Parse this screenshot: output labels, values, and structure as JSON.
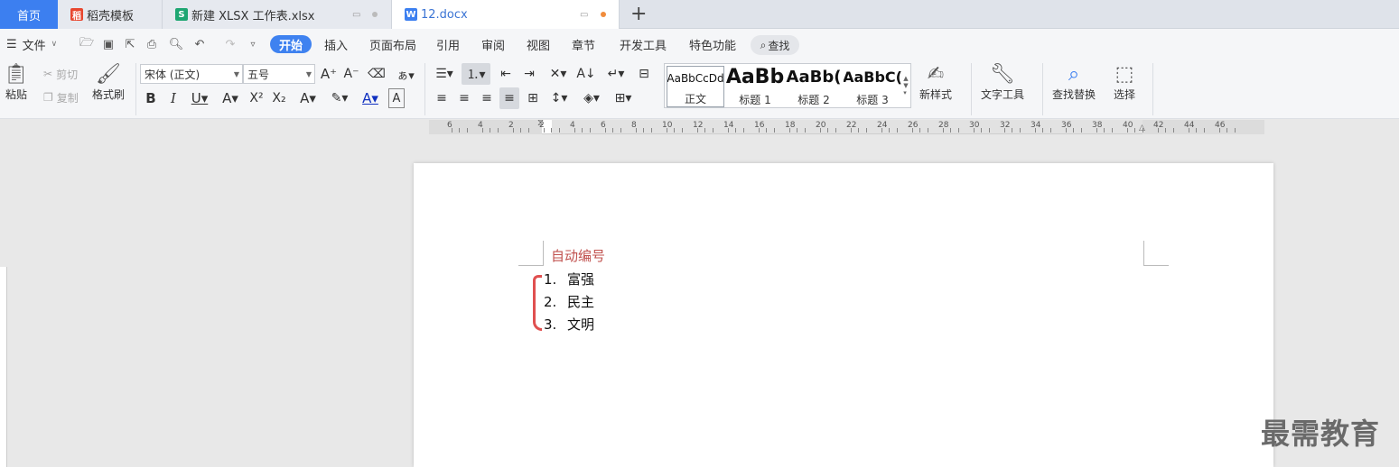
{
  "tabs": {
    "home": "首页",
    "template": "稻壳模板",
    "xlsx": "新建 XLSX 工作表.xlsx",
    "docx": "12.docx"
  },
  "menu": {
    "file": "文件",
    "items": [
      "开始",
      "插入",
      "页面布局",
      "引用",
      "审阅",
      "视图",
      "章节",
      "开发工具",
      "特色功能"
    ],
    "search": "查找"
  },
  "ribbon": {
    "paste": "粘贴",
    "cut": "剪切",
    "copy": "复制",
    "format_painter": "格式刷",
    "font_name": "宋体 (正文)",
    "font_size": "五号",
    "styles": [
      {
        "preview": "AaBbCcDd",
        "name": "正文"
      },
      {
        "preview": "AaBb",
        "name": "标题 1"
      },
      {
        "preview": "AaBb(",
        "name": "标题 2"
      },
      {
        "preview": "AaBbC(",
        "name": "标题 3"
      }
    ],
    "new_style": "新样式",
    "text_tools": "文字工具",
    "find_replace": "查找替换",
    "select": "选择"
  },
  "ruler": {
    "numbers": [
      "6",
      "4",
      "2",
      "2",
      "4",
      "6",
      "8",
      "10",
      "12",
      "14",
      "16",
      "18",
      "20",
      "22",
      "24",
      "26",
      "28",
      "30",
      "32",
      "34",
      "36",
      "38",
      "40",
      "42",
      "44",
      "46"
    ]
  },
  "document": {
    "heading": "自动编号",
    "list": [
      {
        "num": "1.",
        "text": "富强"
      },
      {
        "num": "2.",
        "text": "民主"
      },
      {
        "num": "3.",
        "text": "文明"
      }
    ]
  },
  "watermark": "最需教育",
  "colors": {
    "accent": "#3c7ff0",
    "heading_red": "#c0504d",
    "annotation": "#e05050"
  }
}
